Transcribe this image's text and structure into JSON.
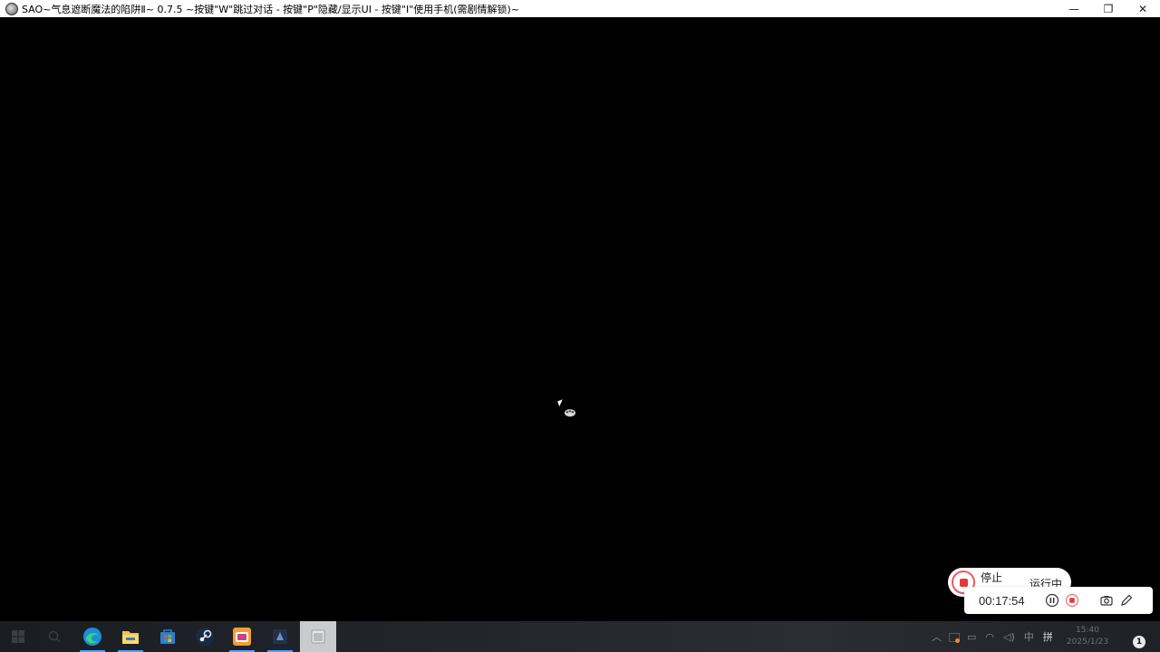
{
  "window": {
    "title": "SAO~气息遮断魔法的陷阱Ⅱ~ 0.7.5 ~按键\"W\"跳过对话 - 按键\"P\"隐藏/显示UI - 按键\"I\"使用手机(需剧情解锁)~",
    "minimize": "—",
    "restore": "❐",
    "close": "✕"
  },
  "recorder": {
    "stop_label": "停止",
    "status_label": "运行中",
    "timer": "00:17:54",
    "accent": "#e5383b"
  },
  "taskbar": {
    "apps": [
      {
        "name": "start-icon"
      },
      {
        "name": "search-icon"
      },
      {
        "name": "edge-icon"
      },
      {
        "name": "file-explorer-icon"
      },
      {
        "name": "store-icon"
      },
      {
        "name": "steam-icon"
      },
      {
        "name": "game-launcher-icon"
      },
      {
        "name": "game-icon"
      },
      {
        "name": "window-icon"
      }
    ],
    "tray": {
      "ime": "中",
      "grid": "拼",
      "time": "15:40",
      "date": "2025/1/23",
      "notifications": "1"
    }
  }
}
